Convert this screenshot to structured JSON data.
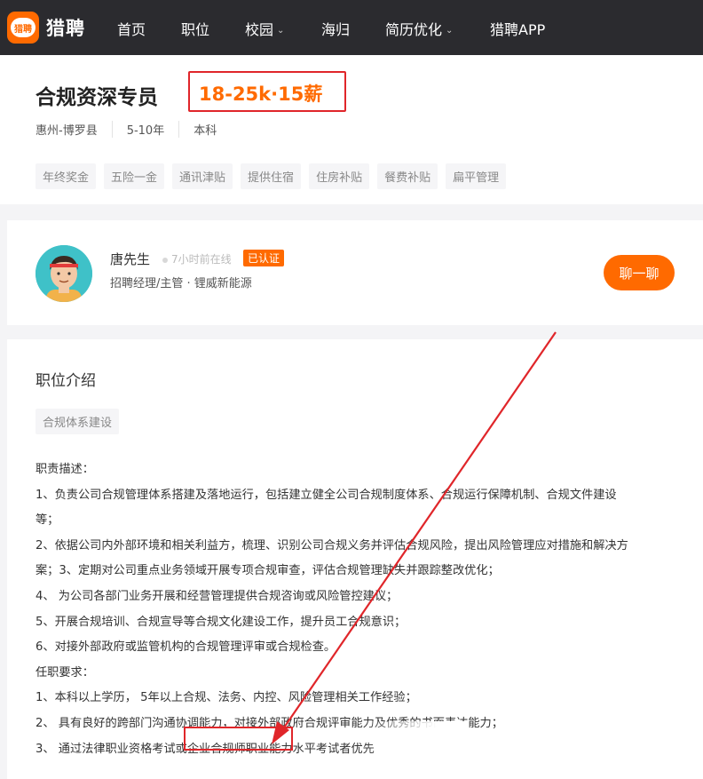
{
  "nav": {
    "logo_badge": "猎聘",
    "logo_text": "猎聘",
    "items": [
      "首页",
      "职位",
      "校园",
      "海归",
      "简历优化",
      "猎聘APP"
    ]
  },
  "job": {
    "title": "合规资深专员",
    "salary": "18-25k·15薪",
    "location": "惠州-博罗县",
    "experience": "5-10年",
    "education": "本科",
    "benefits": [
      "年终奖金",
      "五险一金",
      "通讯津贴",
      "提供住宿",
      "住房补贴",
      "餐费补贴",
      "扁平管理"
    ]
  },
  "recruiter": {
    "name": "唐先生",
    "online": "7小时前在线",
    "verified": "已认证",
    "title": "招聘经理/主管 · 锂威新能源",
    "chat_label": "聊一聊"
  },
  "description": {
    "heading": "职位介绍",
    "tag": "合规体系建设",
    "lines": [
      "职责描述：",
      "1、负责公司合规管理体系搭建及落地运行，包括建立健全公司合规制度体系、合规运行保障机制、合规文件建设",
      "等；",
      "2、依据公司内外部环境和相关利益方，梳理、识别公司合规义务并评估合规风险，提出风险管理应对措施和解决方",
      "案；3、定期对公司重点业务领域开展专项合规审查，评估合规管理缺失并跟踪整改优化；",
      "4、 为公司各部门业务开展和经营管理提供合规咨询或风险管控建议；",
      "5、开展合规培训、合规宣导等合规文化建设工作，提升员工合规意识；",
      "6、对接外部政府或监管机构的合规管理评审或合规检查。",
      "任职要求：",
      "1、本科以上学历， 5年以上合规、法务、内控、风险管理相关工作经验；",
      "2、 具有良好的跨部门沟通协调能力，对接外部政府合规评审能力及优秀的书面表达能力；",
      "3、 通过法律职业资格考试或企业合规师职业能力水平考试者优先"
    ]
  },
  "colors": {
    "accent": "#ff6a00",
    "annotation": "#e0262a",
    "nav_bg": "#2b2b2f"
  }
}
